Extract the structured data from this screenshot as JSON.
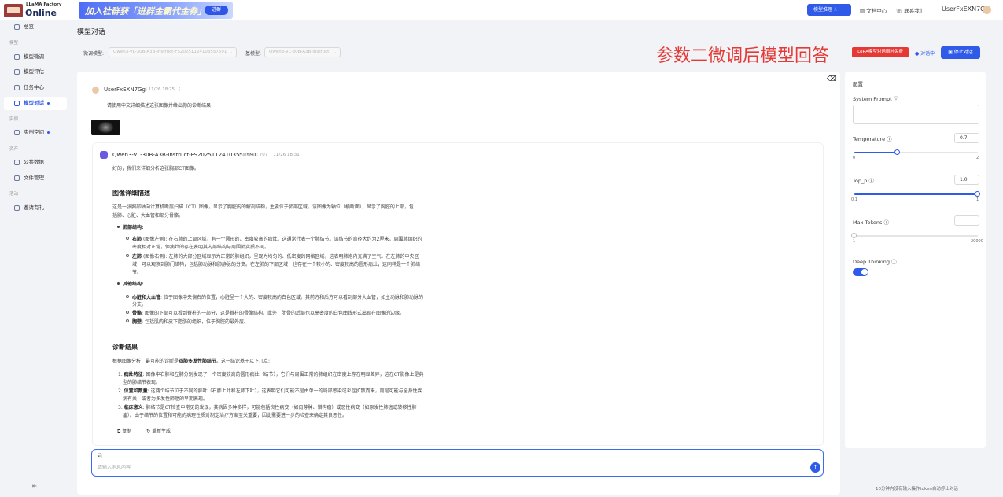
{
  "header": {
    "logo_small": "LLaMA Factory",
    "logo_big": "Online",
    "banner_text": "加入社群获「进群金霸代金券」",
    "banner_button": "进群",
    "inference_button": "模型推理",
    "docs": "文档中心",
    "contact": "联系我们",
    "username": "UserFxEXN7Gg"
  },
  "sidebar": {
    "items": [
      {
        "label": "总览"
      },
      {
        "group": "模型"
      },
      {
        "label": "模型微调"
      },
      {
        "label": "模型评估"
      },
      {
        "label": "任务中心"
      },
      {
        "label": "模型对话",
        "active": true
      },
      {
        "group": "实例"
      },
      {
        "label": "实例空间"
      },
      {
        "group": "资产"
      },
      {
        "label": "公共数据"
      },
      {
        "label": "文件管理"
      },
      {
        "group": "活动"
      },
      {
        "label": "邀请有礼"
      }
    ],
    "collapse_icon": "collapse-icon"
  },
  "page": {
    "title": "模型对话",
    "finetuned_label": "微调模型:",
    "finetuned_value": "Qwen3-VL-30B-A3B-Instruct-FS20251124103557591",
    "base_label": "基模型:",
    "base_value": "Qwen3-VL-30B-A3B-Instruct",
    "annotation": "参数二微调后模型回答",
    "lora_tag": "LoRA模型对话限时免费",
    "status": "对话中",
    "stop_button": "停止对话"
  },
  "chat": {
    "user": {
      "name": "UserFxEXN7Gg",
      "time": "11/26 18:25",
      "text": "请使用中文详细描述这张图像并给出你的诊断结果"
    },
    "assistant": {
      "name": "Qwen3-VL-30B-A3B-Instruct-FS20251124103557591",
      "tokens": "Tokens: 707",
      "time": "11/26 18:31",
      "intro": "好的，我们来详细分析这张胸部CT图像。",
      "h1": "图像详细描述",
      "desc1": "这是一张胸部轴向计算机断层扫描（CT）图像，显示了胸腔内的解剖结构，主要位于肺部区域。该图像为轴位（横断面），显示了胸腔的上部，包",
      "desc2": "括肺、心脏、大血管和部分骨骼。",
      "lung_title": "肺部结构:",
      "lung_r_b": "右肺",
      "lung_r1": "(图像左侧): 在右肺的上部区域，有一个圆形的、密度较高的病灶。这通常代表一个肺结节。该结节的直径大约为2厘米，周围肺组织的",
      "lung_r2": "密度相对正常，但病灶的存在表明其内部结构与周围肺实质不同。",
      "lung_l_b": "左肺",
      "lung_l1": "(图像右侧): 左肺的大部分区域显示为正常的肺组织，呈现为均匀的、低密度的网格区域，这表明肺泡内充满了空气。在左肺的中央区",
      "lung_l2": "域，可以观察到肺门结构，包括肺动脉和肺静脉的分支。在左肺的下部区域，也存在一个较小的、密度较高的圆形病灶，这同样是一个肺结",
      "lung_l3": "节。",
      "other_title": "其他结构:",
      "heart_b": "心脏和大血管",
      "heart1": ": 位于图像中央偏右的位置，心脏呈一个大的、密度较高的白色区域。其前方和后方可以看到部分大血管，如主动脉和肺动脉的",
      "heart2": "分支。",
      "bone_b": "骨骼",
      "bone": ": 图像的下部可以看到脊柱的一部分，这是脊柱的骨骼结构。此外，肋骨的后部也以高密度的白色曲线形式出现在图像的边缘。",
      "chest_b": "胸壁",
      "chest": ": 包括肌肉和皮下脂肪的组织，位于胸腔的最外层。",
      "h2": "诊断结果",
      "diag_pre": "根据图像分析，最可能的诊断是",
      "diag_b": "双肺多发性肺结节",
      "diag_post": "。这一结论基于以下几点:",
      "d1_b": "病灶特征",
      "d1a": ": 图像中右肺和左肺分别发现了一个密度较高的圆形病灶（结节），它们与周围正常的肺组织在密度上存在明显差异，这在CT影像上是典",
      "d1b": "型的肺结节表现。",
      "d2_b": "位置和数量",
      "d2a": ": 这两个结节位于不同的肺叶（右肺上叶和左肺下叶），这表明它们可能不是由单一的局部感染或炎症扩散而来，而是可能与全身性疾",
      "d2b": "病有关，或者为多发性肺癌的早期表现。",
      "d3_b": "临床意义",
      "d3a": ": 肺结节是CT检查中常见的发现，其病因多种多样，可能包括良性病变（如肉芽肿、错构瘤）或恶性病变（如原发性肺癌或转移性肺",
      "d3b": "瘤）。由于结节的位置和可能的病理性质对制定治疗方案至关重要，因此需要进一步的检查来确定其良恶性。",
      "copy": "复制",
      "regenerate": "重新生成"
    },
    "input_placeholder": "请输入消息内容"
  },
  "config": {
    "title": "配置",
    "system_prompt": "System Prompt",
    "temperature": {
      "label": "Temperature",
      "value": "0.7",
      "min": "0",
      "max": "2",
      "fraction": 0.35
    },
    "top_p": {
      "label": "Top_p",
      "value": "1.0",
      "min": "0.1",
      "max": "1",
      "fraction": 1.0
    },
    "max_tokens": {
      "label": "Max Tokens",
      "value": "",
      "min": "1",
      "max": "20000",
      "fraction": 0.0
    },
    "deep_thinking": {
      "label": "Deep Thinking",
      "on": true
    },
    "footnote": "10分钟内没有输入操作token自动停止对话"
  },
  "colors": {
    "accent": "#2f5be8",
    "annotation": "#e53935"
  }
}
